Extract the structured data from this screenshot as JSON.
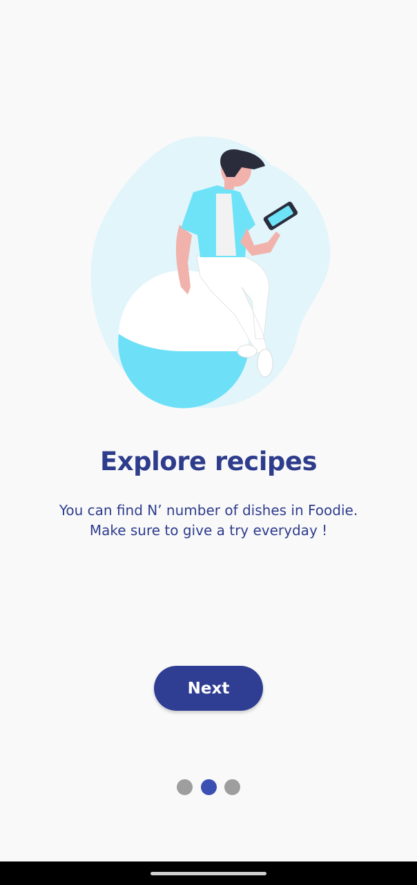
{
  "onboarding": {
    "title": "Explore recipes",
    "description_line1": "You can find N’ number of dishes in Foodie.",
    "description_line2": "Make sure to give a try everyday !",
    "next_label": "Next",
    "page_indicator": {
      "total_pages": 3,
      "current_page": 2
    },
    "illustration_icon": "person-on-ball-with-phone-illustration"
  },
  "colors": {
    "background": "#f9f9f9",
    "primary": "#2e3c8c",
    "active_dot": "#3c4fb3",
    "inactive_dot": "#9e9e9e",
    "accent": "#6ee3f8"
  }
}
